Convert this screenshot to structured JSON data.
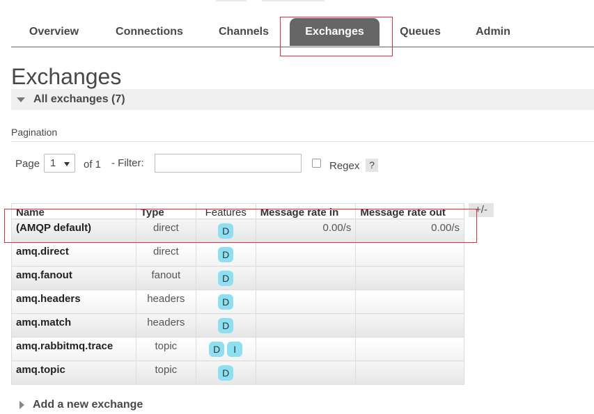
{
  "nav": {
    "tabs": [
      {
        "label": "Overview"
      },
      {
        "label": "Connections"
      },
      {
        "label": "Channels"
      },
      {
        "label": "Exchanges",
        "active": true
      },
      {
        "label": "Queues"
      },
      {
        "label": "Admin"
      }
    ]
  },
  "page": {
    "title": "Exchanges"
  },
  "section": {
    "title": "All exchanges (7)"
  },
  "pagination": {
    "heading": "Pagination",
    "page_label": "Page",
    "page_value": "1",
    "of_label": "of 1",
    "filter_label": "- Filter:",
    "filter_value": "",
    "regex_label": "Regex",
    "regex_checked": false,
    "help_label": "?"
  },
  "table": {
    "headers": {
      "name": "Name",
      "type": "Type",
      "features": "Features",
      "rate_in": "Message rate in",
      "rate_out": "Message rate out"
    },
    "toggle_columns_label": "+/-",
    "rows": [
      {
        "name": "(AMQP default)",
        "type": "direct",
        "features": [
          "D"
        ],
        "rate_in": "0.00/s",
        "rate_out": "0.00/s"
      },
      {
        "name": "amq.direct",
        "type": "direct",
        "features": [
          "D"
        ],
        "rate_in": "",
        "rate_out": ""
      },
      {
        "name": "amq.fanout",
        "type": "fanout",
        "features": [
          "D"
        ],
        "rate_in": "",
        "rate_out": ""
      },
      {
        "name": "amq.headers",
        "type": "headers",
        "features": [
          "D"
        ],
        "rate_in": "",
        "rate_out": ""
      },
      {
        "name": "amq.match",
        "type": "headers",
        "features": [
          "D"
        ],
        "rate_in": "",
        "rate_out": ""
      },
      {
        "name": "amq.rabbitmq.trace",
        "type": "topic",
        "features": [
          "D",
          "I"
        ],
        "rate_in": "",
        "rate_out": ""
      },
      {
        "name": "amq.topic",
        "type": "topic",
        "features": [
          "D"
        ],
        "rate_in": "",
        "rate_out": ""
      }
    ]
  },
  "add_section": {
    "title": "Add a new exchange"
  },
  "colors": {
    "active_tab_bg": "#666666",
    "badge_bg": "#8de0f2",
    "highlight_border": "#dd3333"
  }
}
